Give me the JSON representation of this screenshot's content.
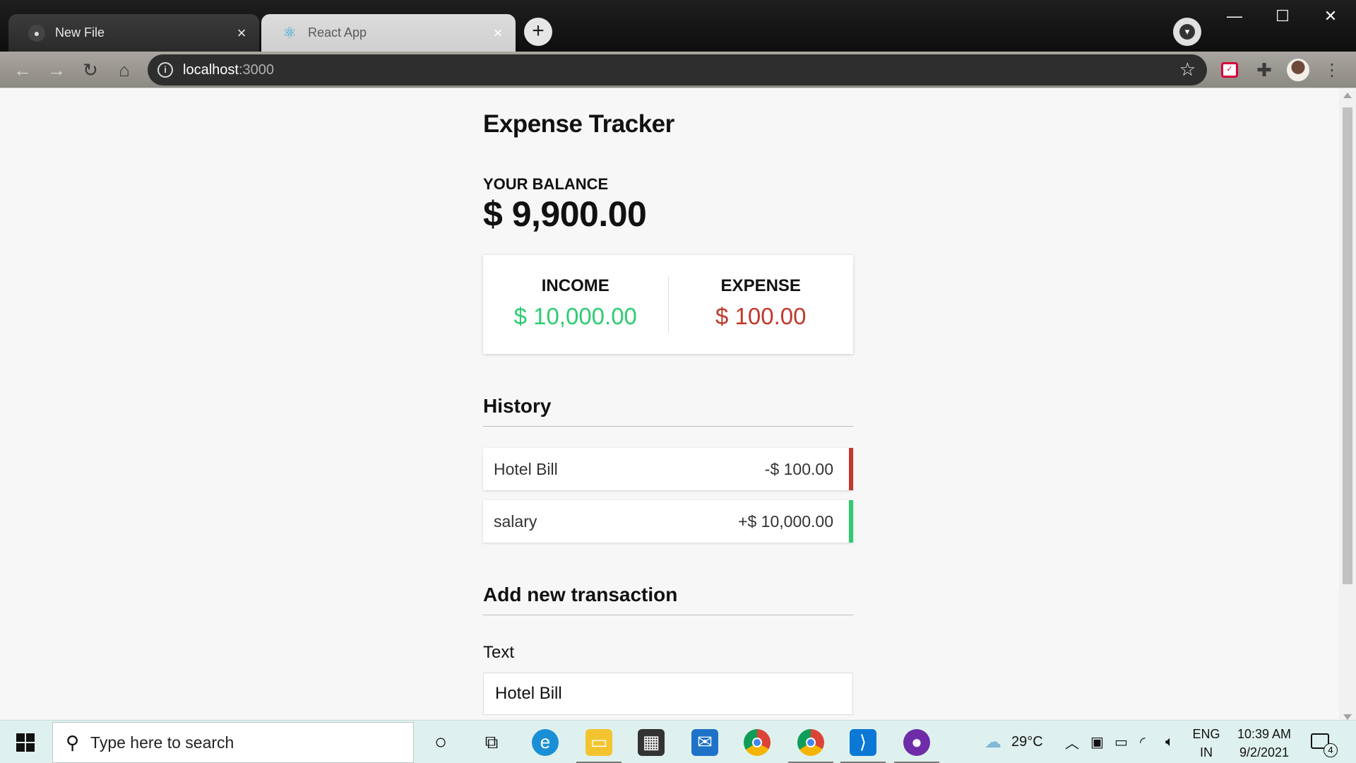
{
  "browser": {
    "tabs": [
      {
        "title": "New File",
        "favicon": "github-icon",
        "active": false
      },
      {
        "title": "React App",
        "favicon": "react-icon",
        "active": true
      }
    ],
    "url_host": "localhost",
    "url_port": ":3000"
  },
  "app": {
    "title": "Expense Tracker",
    "balance_label": "YOUR BALANCE",
    "balance": "$ 9,900.00",
    "income_label": "INCOME",
    "income": "$ 10,000.00",
    "expense_label": "EXPENSE",
    "expense": "$ 100.00",
    "history_title": "History",
    "history": [
      {
        "text": "Hotel Bill",
        "amount": "-$ 100.00",
        "type": "minus"
      },
      {
        "text": "salary",
        "amount": "+$ 10,000.00",
        "type": "plus"
      }
    ],
    "add_title": "Add new transaction",
    "text_label": "Text",
    "text_value": "Hotel Bill"
  },
  "taskbar": {
    "search_placeholder": "Type here to search",
    "weather": "29°C",
    "lang_1": "ENG",
    "lang_2": "IN",
    "time": "10:39 AM",
    "date": "9/2/2021",
    "notification_count": "4"
  },
  "colors": {
    "income": "#2ecc71",
    "expense": "#c0392b"
  }
}
